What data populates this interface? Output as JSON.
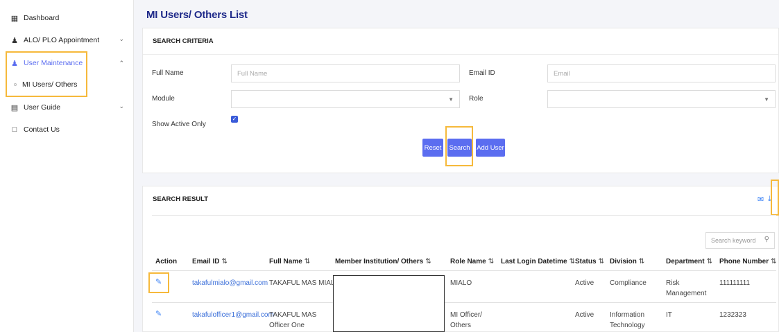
{
  "sidebar": {
    "items": [
      {
        "label": "Dashboard",
        "icon": "grid-icon"
      },
      {
        "label": "ALO/ PLO Appointment",
        "icon": "user-add-icon"
      },
      {
        "label": "User Maintenance",
        "icon": "users-icon"
      },
      {
        "label": "MI Users/ Others",
        "icon": "dot-icon"
      },
      {
        "label": "User Guide",
        "icon": "document-icon"
      },
      {
        "label": "Contact Us",
        "icon": "chat-icon"
      }
    ]
  },
  "page": {
    "title": "MI Users/ Others List"
  },
  "search_criteria": {
    "heading": "SEARCH CRITERIA",
    "full_name_label": "Full Name",
    "full_name_placeholder": "Full Name",
    "email_label": "Email ID",
    "email_placeholder": "Email",
    "module_label": "Module",
    "role_label": "Role",
    "active_only_label": "Show Active Only",
    "reset_label": "Reset",
    "search_label": "Search",
    "add_user_label": "Add User"
  },
  "search_result": {
    "heading": "SEARCH RESULT",
    "keyword_placeholder": "Search keyword",
    "columns": [
      "Action",
      "Email ID",
      "Full Name",
      "Member Institution/ Others",
      "Role Name",
      "Last Login Datetime",
      "Status",
      "Division",
      "Department",
      "Phone Number"
    ],
    "rows": [
      {
        "email": "takafulmialo@gmail.com",
        "full_name": "TAKAFUL MAS MIALO",
        "role": "MIALO",
        "last_login": "",
        "status": "Active",
        "division": "Compliance",
        "department": "Risk Management",
        "phone": "111111111"
      },
      {
        "email": "takafulofficer1@gmail.com",
        "full_name": "TAKAFUL MAS Officer One",
        "role": "MI Officer/ Others",
        "last_login": "",
        "status": "Active",
        "division": "Information Technology",
        "department": "IT",
        "phone": "1232323"
      }
    ]
  },
  "colors": {
    "accent": "#5b6df0",
    "title": "#1f2a8a",
    "link": "#3b6fd9",
    "highlight": "#f6b93b"
  }
}
